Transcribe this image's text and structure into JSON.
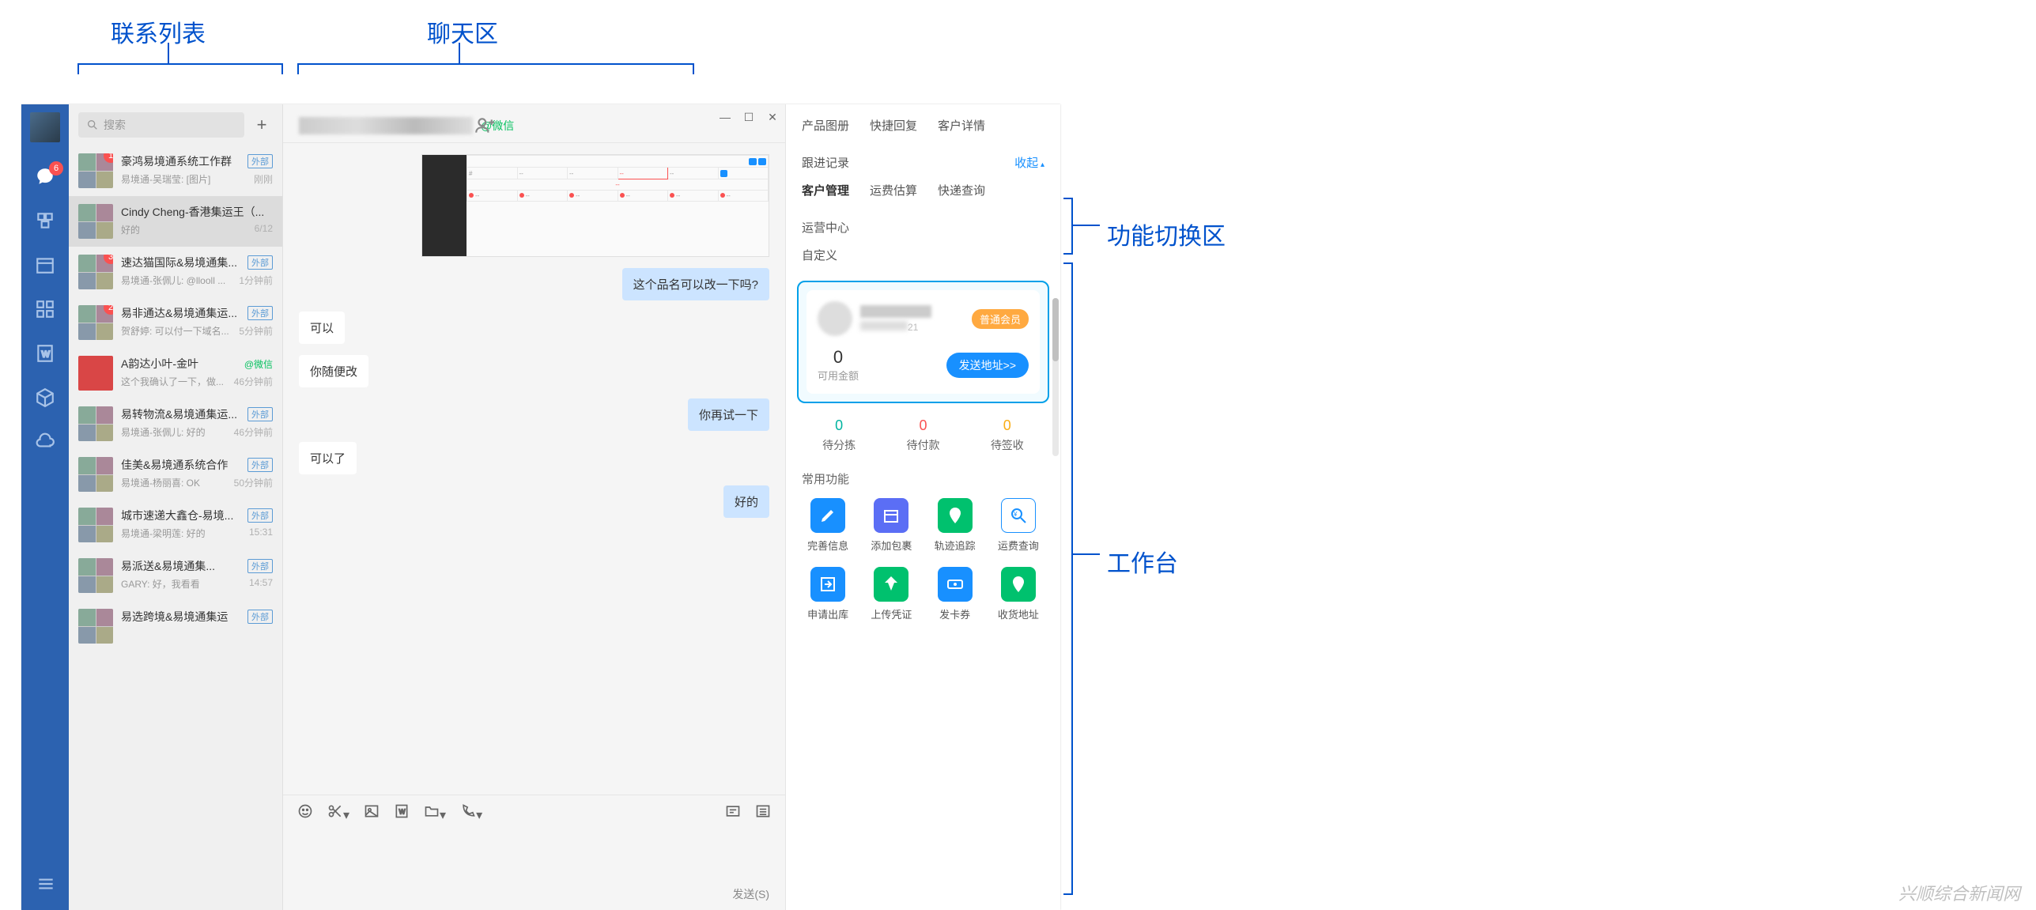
{
  "annotations": {
    "contact_list": "联系列表",
    "chat_area": "聊天区",
    "func_switch": "功能切换区",
    "workbench": "工作台",
    "watermark": "兴顺综合新闻网"
  },
  "sidebar": {
    "chat_badge": "6"
  },
  "search": {
    "placeholder": "搜索"
  },
  "contacts": [
    {
      "name": "豪鸿易境通系统工作群",
      "ext": "外部",
      "badge": "1",
      "preview": "易境通-吴瑞莹: [图片]",
      "time": "刚刚"
    },
    {
      "name": "Cindy Cheng-香港集运王（...",
      "preview": "好的",
      "time": "6/12",
      "active": true
    },
    {
      "name": "速达猫国际&易境通集...",
      "ext": "外部",
      "badge": "3",
      "preview": "易境通-张佩儿: @llooll ...",
      "time": "1分钟前"
    },
    {
      "name": "易非通达&易境通集运...",
      "ext": "外部",
      "badge": "2",
      "preview": "贺舒婷: 可以付一下域名...",
      "time": "5分钟前"
    },
    {
      "name": "A韵达小叶-金叶",
      "wx": "@微信",
      "preview": "这个我确认了一下，做...",
      "time": "46分钟前"
    },
    {
      "name": "易转物流&易境通集运...",
      "ext": "外部",
      "preview": "易境通-张佩儿: 好的",
      "time": "46分钟前"
    },
    {
      "name": "佳美&易境通系统合作",
      "ext": "外部",
      "preview": "易境通-杨丽喜: OK",
      "time": "50分钟前"
    },
    {
      "name": "城市速递大鑫仓-易境...",
      "ext": "外部",
      "preview": "易境通-梁明莲: 好的",
      "time": "15:31"
    },
    {
      "name": "易派送&易境通集...",
      "ext": "外部",
      "preview": "GARY: 好，我看看",
      "time": "14:57"
    },
    {
      "name": "易选跨境&易境通集运",
      "ext": "外部",
      "preview": "",
      "time": ""
    }
  ],
  "chat": {
    "title_tag": "@微信",
    "msgs": {
      "m1": "这个品名可以改一下吗?",
      "m2": "可以",
      "m3": "你随便改",
      "m4": "你再试一下",
      "m5": "可以了",
      "m6": "好的"
    },
    "send_label": "发送(S)"
  },
  "work": {
    "tabs1": {
      "a": "产品图册",
      "b": "快捷回复",
      "c": "客户详情",
      "d": "跟进记录",
      "collapse": "收起"
    },
    "tabs2": {
      "a": "客户管理",
      "b": "运费估算",
      "c": "快递查询",
      "d": "运营中心"
    },
    "tabs3": {
      "a": "自定义"
    },
    "customer": {
      "id_suffix": "21",
      "member_badge": "普通会员",
      "balance_num": "0",
      "balance_label": "可用金额",
      "send_addr": "发送地址>>"
    },
    "stats": [
      {
        "num": "0",
        "label": "待分拣"
      },
      {
        "num": "0",
        "label": "待付款"
      },
      {
        "num": "0",
        "label": "待签收"
      }
    ],
    "common_title": "常用功能",
    "funcs": [
      {
        "label": "完善信息",
        "color": "blue",
        "icon": "edit"
      },
      {
        "label": "添加包裹",
        "color": "purple",
        "icon": "box"
      },
      {
        "label": "轨迹追踪",
        "color": "green",
        "icon": "pin"
      },
      {
        "label": "运费查询",
        "color": "white",
        "icon": "search"
      },
      {
        "label": "申请出库",
        "color": "blue",
        "icon": "out"
      },
      {
        "label": "上传凭证",
        "color": "green",
        "icon": "upload"
      },
      {
        "label": "发卡券",
        "color": "blue",
        "icon": "ticket"
      },
      {
        "label": "收货地址",
        "color": "green",
        "icon": "addr"
      }
    ]
  }
}
